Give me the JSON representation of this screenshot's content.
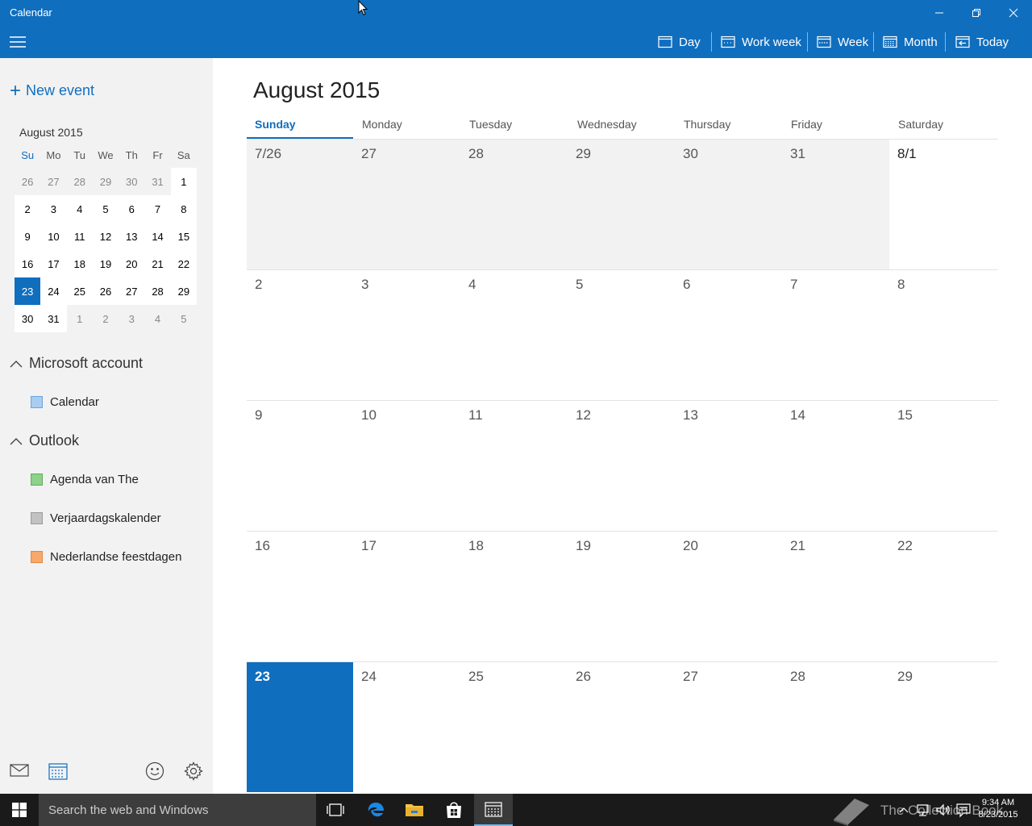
{
  "window": {
    "title": "Calendar"
  },
  "toolbar": {
    "views": [
      {
        "label": "Day",
        "icon": "day-view-icon"
      },
      {
        "label": "Work week",
        "icon": "work-week-icon"
      },
      {
        "label": "Week",
        "icon": "week-icon"
      },
      {
        "label": "Month",
        "icon": "month-icon"
      },
      {
        "label": "Today",
        "icon": "today-icon"
      }
    ]
  },
  "sidebar": {
    "new_event_label": "New event",
    "mini_calendar": {
      "title": "August 2015",
      "weekday_headers": [
        "Su",
        "Mo",
        "Tu",
        "We",
        "Th",
        "Fr",
        "Sa"
      ],
      "weeks": [
        [
          "26",
          "27",
          "28",
          "29",
          "30",
          "31",
          "1"
        ],
        [
          "2",
          "3",
          "4",
          "5",
          "6",
          "7",
          "8"
        ],
        [
          "9",
          "10",
          "11",
          "12",
          "13",
          "14",
          "15"
        ],
        [
          "16",
          "17",
          "18",
          "19",
          "20",
          "21",
          "22"
        ],
        [
          "23",
          "24",
          "25",
          "26",
          "27",
          "28",
          "29"
        ],
        [
          "30",
          "31",
          "1",
          "2",
          "3",
          "4",
          "5"
        ]
      ]
    },
    "groups": [
      {
        "name": "Microsoft account",
        "calendars": [
          {
            "name": "Calendar",
            "color": "#a9cdf0",
            "border": "#6aa4dc"
          }
        ]
      },
      {
        "name": "Outlook",
        "calendars": [
          {
            "name": "Agenda van The",
            "color": "#8dd18d",
            "border": "#5cb05c"
          },
          {
            "name": "Verjaardagskalender",
            "color": "#c2c2c2",
            "border": "#9a9a9a"
          },
          {
            "name": "Nederlandse feestdagen",
            "color": "#f7a86a",
            "border": "#e08843"
          }
        ]
      }
    ]
  },
  "main": {
    "month_title": "August 2015",
    "day_headers": [
      "Sunday",
      "Monday",
      "Tuesday",
      "Wednesday",
      "Thursday",
      "Friday",
      "Saturday"
    ],
    "weeks": [
      [
        "7/26",
        "27",
        "28",
        "29",
        "30",
        "31",
        "8/1"
      ],
      [
        "2",
        "3",
        "4",
        "5",
        "6",
        "7",
        "8"
      ],
      [
        "9",
        "10",
        "11",
        "12",
        "13",
        "14",
        "15"
      ],
      [
        "16",
        "17",
        "18",
        "19",
        "20",
        "21",
        "22"
      ],
      [
        "23",
        "24",
        "25",
        "26",
        "27",
        "28",
        "29"
      ]
    ]
  },
  "taskbar": {
    "search_placeholder": "Search the web and Windows",
    "time": "9:34 AM",
    "date": "8/23/2015",
    "watermark": "The Collection Book"
  },
  "colors": {
    "accent": "#106ebe",
    "sidebar_bg": "#f2f2f2"
  }
}
